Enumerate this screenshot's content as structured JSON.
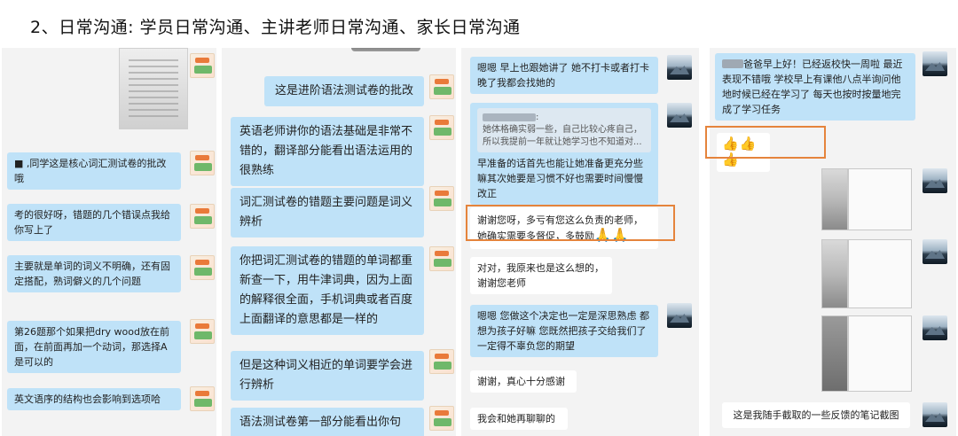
{
  "heading": "2、日常沟通: 学员日常沟通、主讲老师日常沟通、家长日常沟通",
  "panel1": {
    "messages": [
      "■ ,同学这是核心词汇测试卷的批改哦",
      "考的很好呀，错题的几个错误点我给你写上了",
      "主要就是单词的词义不明确，还有固定搭配，熟词僻义的几个问题",
      "第26题那个如果把dry wood放在前面，在前面再加一个动词，那选择A是可以的",
      "英文语序的结构也会影响到选项哈"
    ]
  },
  "panel2": {
    "messages": [
      "这是进阶语法测试卷的批改",
      "英语老师讲你的语法基础是非常不错的，翻译部分能看出语法运用的很熟练",
      "词汇测试卷的错题主要问题是词义辨析",
      "你把词汇测试卷的错题的单词都重新查一下，用牛津词典，因为上面的解释很全面，手机词典或者百度上面翻译的意思都是一样的",
      "但是这种词义相近的单词要学会进行辨析",
      "语法测试卷第一部分能看出你句"
    ]
  },
  "panel3": {
    "messages": [
      "嗯嗯 早上也跟她讲了 她不打卡或者打卡晚了我都会找她的",
      "早准备的话首先也能让她准备更充分些嘛其次她要是习惯不好也需要时间慢慢改正",
      "谢谢您呀，多亏有您这么负责的老师，她确实需要多督促，多鼓励",
      "对对，我原来也是这么想的，谢谢您老师",
      "嗯嗯 您做这个决定也一定是深思熟虑 都想为孩子好嘛 您既然把孩子交给我们了一定得不辜负您的期望",
      "谢谢，真心十分感谢",
      "我会和她再聊聊的"
    ],
    "quote": {
      "suffix": ":",
      "text": "她体格确实弱一些，自己比较心疼自己，所以我提前一年就让她学习也不知道对..."
    },
    "emoji": "🙏🙏"
  },
  "panel4": {
    "messages": [
      "爸爸早上好！已经返校快一周啦 最近表现不错哦 学校早上有课他八点半询问他地时候已经在学习了 每天也按时按量地完成了学习任务",
      "这是我随手截取的一些反馈的笔记截图"
    ],
    "emoji": "👍👍👍"
  }
}
